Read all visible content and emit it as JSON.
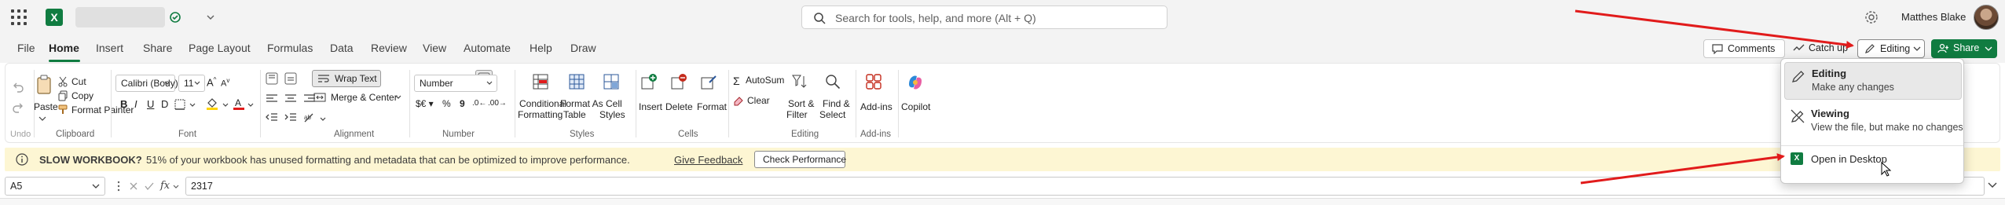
{
  "titlebar": {
    "search_placeholder": "Search for tools, help, and more (Alt + Q)",
    "username": "Matthes Blake"
  },
  "tabs": [
    "File",
    "Home",
    "Insert",
    "Share",
    "Page Layout",
    "Formulas",
    "Data",
    "Review",
    "View",
    "Automate",
    "Help",
    "Draw"
  ],
  "active_tab": "Home",
  "actions": {
    "comments": "Comments",
    "catchup": "Catch up",
    "editing": "Editing",
    "share": "Share"
  },
  "ribbon": {
    "undo": "Undo",
    "paste": "Paste",
    "cut": "Cut",
    "copy": "Copy",
    "format_painter": "Format Painter",
    "clipboard_label": "Clipboard",
    "font_name": "Calibri (Body)",
    "font_size": "11",
    "font_label": "Font",
    "wrap_text": "Wrap Text",
    "merge_center": "Merge & Center",
    "alignment_label": "Alignment",
    "number_format": "Number",
    "number_label": "Number",
    "conditional_formatting": [
      "Conditional",
      "Formatting"
    ],
    "format_as_table": [
      "Format As",
      "Table"
    ],
    "cell_styles": [
      "Cell",
      "Styles"
    ],
    "styles_label": "Styles",
    "insert": "Insert",
    "delete": "Delete",
    "format": "Format",
    "cells_label": "Cells",
    "autosum": "AutoSum",
    "clear": "Clear",
    "sort_filter": [
      "Sort &",
      "Filter"
    ],
    "find_select": [
      "Find &",
      "Select"
    ],
    "editing_label": "Editing",
    "addins": "Add-ins",
    "addins_label": "Add-ins",
    "copilot": "Copilot"
  },
  "message": {
    "title": "SLOW WORKBOOK?",
    "text": "51% of your workbook has unused formatting and metadata that can be optimized to improve performance.",
    "link": "Give Feedback",
    "button": "Check Performance"
  },
  "formula_bar": {
    "cell_ref": "A5",
    "value": "2317"
  },
  "mode_menu": {
    "items": [
      {
        "title": "Editing",
        "subtitle": "Make any changes",
        "selected": true
      },
      {
        "title": "Viewing",
        "subtitle": "View the file, but make no changes",
        "selected": false
      }
    ],
    "desktop": "Open in Desktop"
  },
  "colors": {
    "accent": "#107c41",
    "annotation_arrow": "#e11b1b",
    "message_bar": "#fdf6d3"
  }
}
